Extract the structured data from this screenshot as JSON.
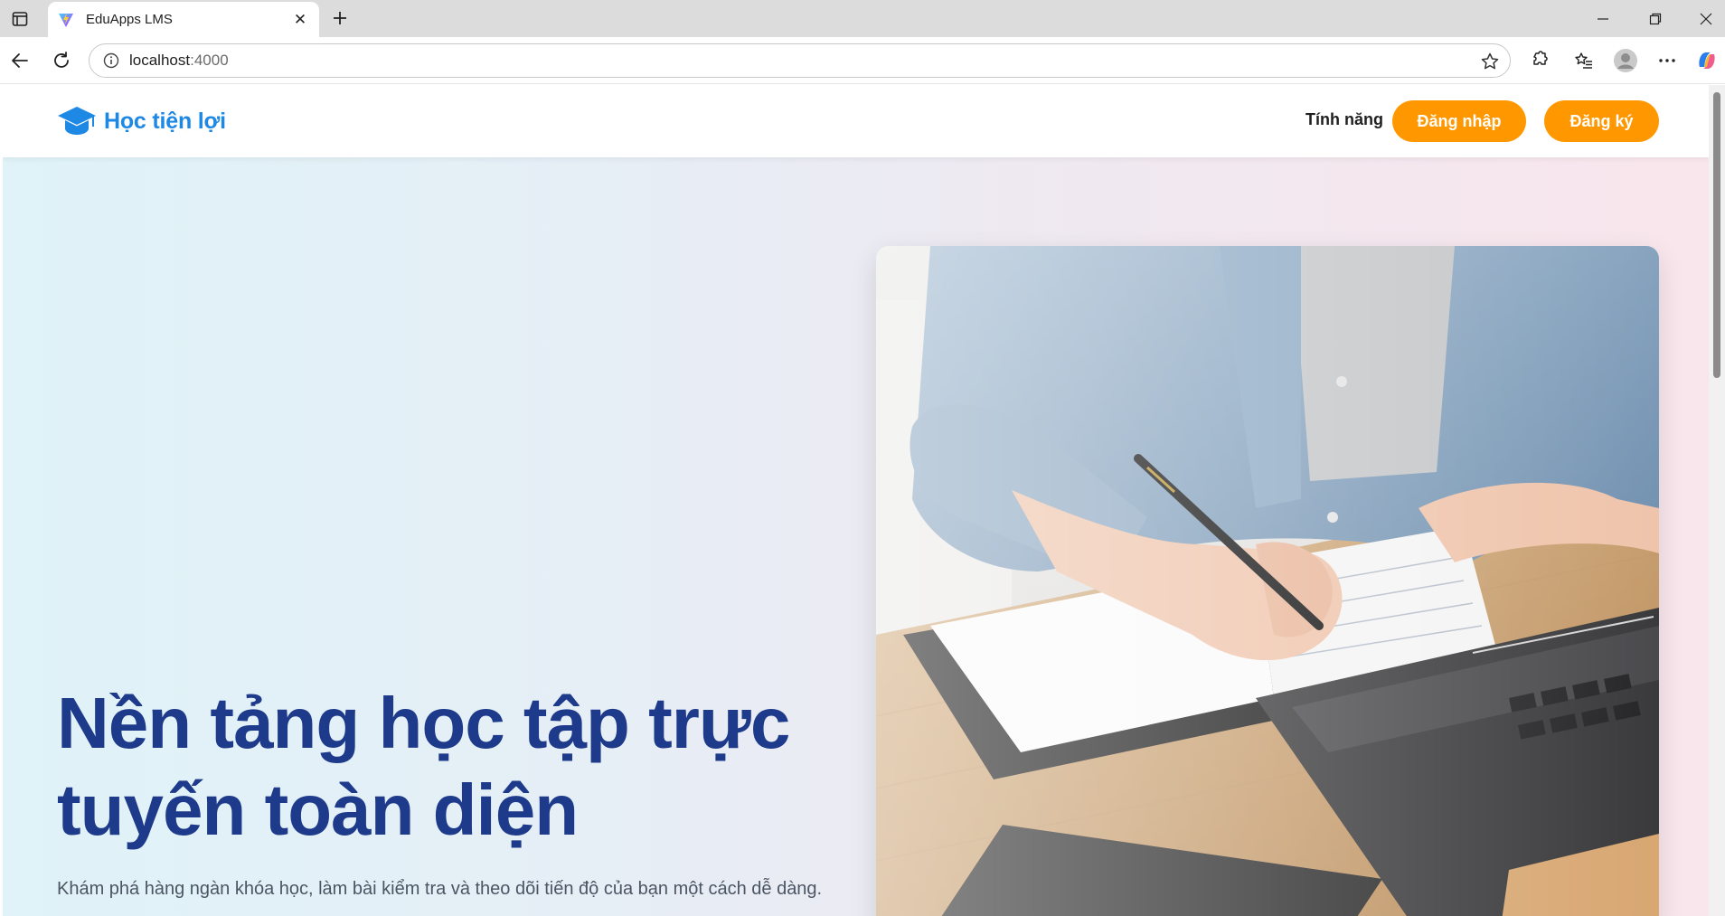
{
  "browser": {
    "tab_title": "EduApps LMS",
    "tab_close": "✕",
    "address_host": "localhost",
    "address_port": ":4000"
  },
  "site": {
    "logo_text": "Học tiện lợi",
    "nav_feature": "Tính năng",
    "login_label": "Đăng nhập",
    "register_label": "Đăng ký"
  },
  "hero": {
    "title": "Nền tảng học tập trực tuyến toàn diện",
    "subtitle": "Khám phá hàng ngàn khóa học, làm bài kiểm tra và theo dõi tiến độ của bạn một cách dễ dàng."
  },
  "colors": {
    "brand_blue": "#1e88e5",
    "accent_orange": "#ff9800",
    "title_navy": "#1e3a8a"
  }
}
